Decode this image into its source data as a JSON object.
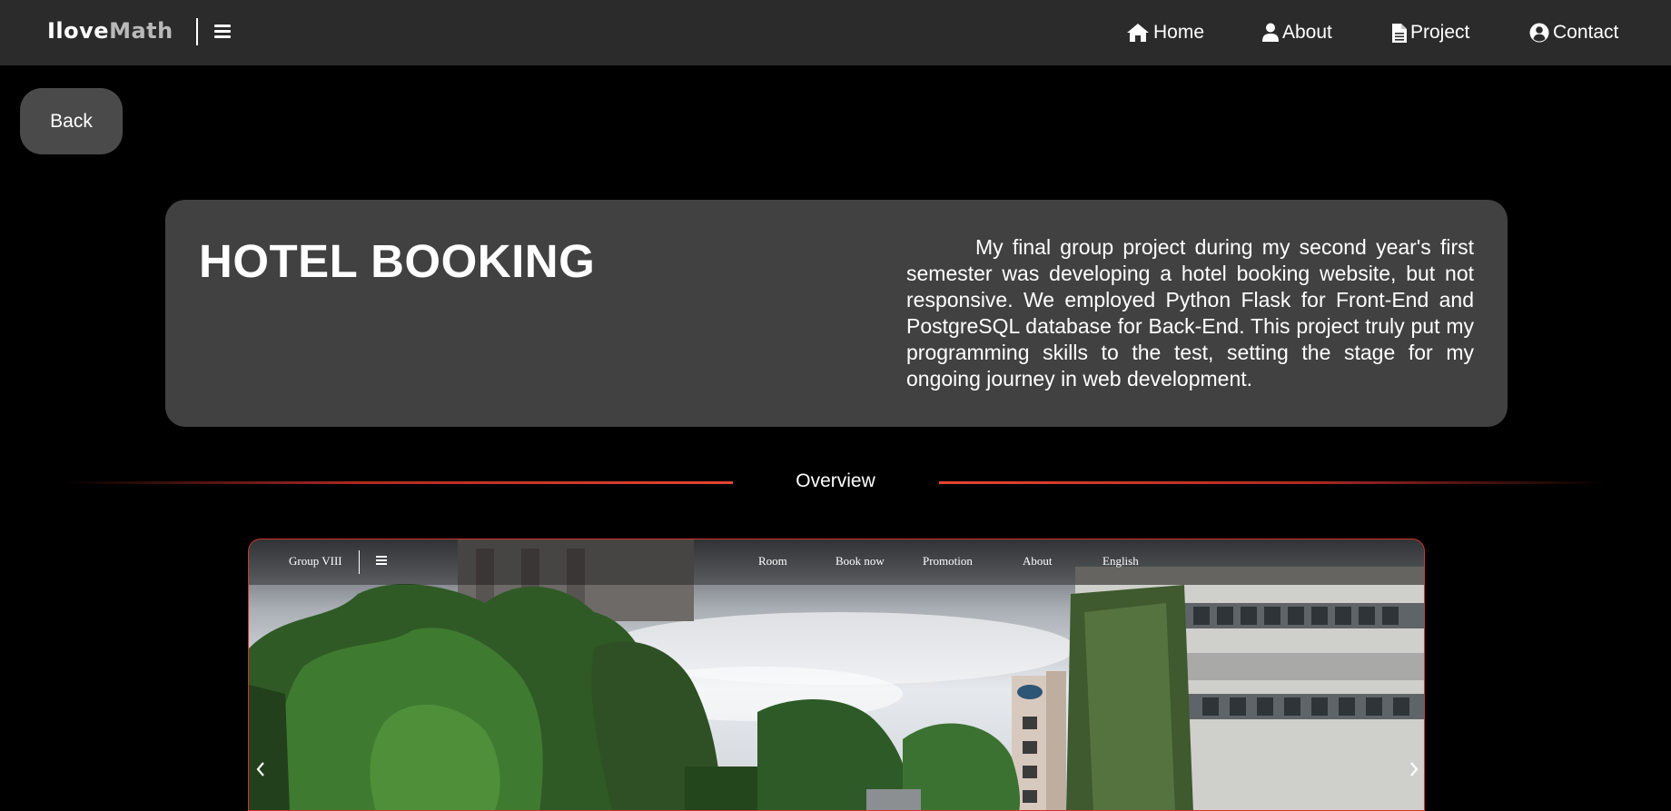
{
  "brand": {
    "part1": "Ilove",
    "part2": "Math"
  },
  "nav": {
    "items": [
      {
        "label": "Home",
        "icon": "home-icon"
      },
      {
        "label": "About",
        "icon": "user-icon"
      },
      {
        "label": "Project",
        "icon": "file-icon"
      },
      {
        "label": "Contact",
        "icon": "user-circle-icon"
      }
    ]
  },
  "back_button": {
    "label": "Back"
  },
  "project": {
    "title": "HOTEL BOOKING",
    "description": "My final group project during my second year's first semester was developing a hotel booking website, but not responsive. We employed Python Flask for Front-End and PostgreSQL database for Back-End. This project truly put my programming skills to the test, setting the stage for my ongoing journey in web development."
  },
  "section": {
    "label": "Overview"
  },
  "screenshot": {
    "brand": "Group VIII",
    "links": [
      "Room",
      "Book now",
      "Promotion",
      "About",
      "English"
    ]
  },
  "colors": {
    "nav_bg": "#2b2b2c",
    "card_bg": "#414141",
    "button_bg": "#4a4a4a",
    "accent": "#e44533",
    "page_bg": "#000000"
  }
}
